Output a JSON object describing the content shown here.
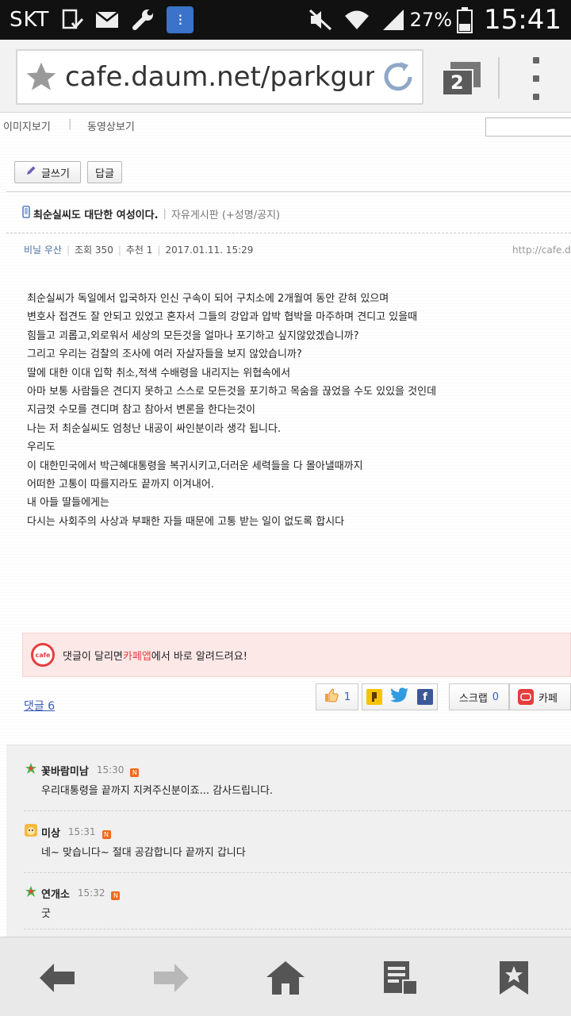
{
  "status_bar": {
    "carrier": "SKT",
    "battery_percent": "27%",
    "time": "15:41"
  },
  "browser": {
    "url": "cafe.daum.net/parkgun",
    "tab_count": "2"
  },
  "page": {
    "top_nav": {
      "image_view": "이미지보기",
      "separator": "|",
      "video_view": "동영상보기"
    },
    "buttons": {
      "write": "글쓰기",
      "reply": "답글"
    },
    "post": {
      "title": "최순실씨도 대단한 여성이다.",
      "title_sep": "|",
      "board": "자유게시판 (+성명/공지)",
      "author": "비닐 우산",
      "views": "조회 350",
      "recommends": "추천 1",
      "date": "2017.01.11. 15:29",
      "source_url": "http://cafe.d",
      "body_lines": [
        "최순실씨가 독일에서 입국하자 인신 구속이 되어 구치소에 2개월여 동안 갇혀 있으며",
        "변호사 접견도 잘 안되고 있었고 혼자서 그들의 강압과 압박 협박을 마주하며 견디고 있을때",
        "힘들고 괴롭고,외로워서 세상의 모든것을 얼마나 포기하고 싶지않았겠습니까?",
        "그리고 우리는 검찰의 조사에 여러 자살자들을 보지 않았습니까?",
        "딸에 대한 이대 입학 취소,적색 수배령을 내리지는 위협속에서",
        "아마 보통 사람들은 견디지 못하고 스스로 모든것을 포기하고 목숨을 끊었을 수도 있있을 것인데",
        "지금껏 수모를 견디며 참고 참아서 변론을 한다는것이",
        "나는 저 최순실씨도 엄청난 내공이 싸인분이라 생각 됩니다.",
        "우리도",
        "이 대한민국에서 박근혜대통령을 복귀시키고,더러운 세력들을 다 몰아낼때까지",
        "어떠한 고통이 따를지라도 끝까지 이겨내어.",
        "내 아들 딸들에게는",
        "다시는 사회주의 사상과 부패한 자들 때문에 고통 받는 일이 없도록 합시다"
      ]
    },
    "notice": {
      "badge": "cafe",
      "text_before": "댓글이 달리면 ",
      "highlight": "카페앱",
      "text_after": "에서 바로 알려드려요!"
    },
    "comment_count_label": "댓글 6",
    "share": {
      "like_count": "1",
      "scrap_label": "스크랩",
      "scrap_count": "0",
      "cafe_label": "카페"
    },
    "comments": [
      {
        "name": "꽃바람미남",
        "time": "15:30",
        "new": "N",
        "text": "우리대통령을 끝까지 지켜주신분이죠... 감사드립니다."
      },
      {
        "name": "미상",
        "time": "15:31",
        "new": "N",
        "text": "네~ 맞습니다~ 절대 공감합니다 끝까지 갑니다"
      },
      {
        "name": "연개소",
        "time": "15:32",
        "new": "N",
        "text": "굿"
      }
    ]
  },
  "icons": {
    "status": [
      "screenshot-check-icon",
      "mail-icon",
      "wrench-icon",
      "app-tile-icon",
      "mute-icon",
      "wifi-icon",
      "signal-icon",
      "battery-icon"
    ],
    "browser": [
      "bookmark-star-icon",
      "reload-icon",
      "tabs-icon",
      "overflow-menu-icon"
    ],
    "bottom_nav": [
      "back-arrow-icon",
      "forward-arrow-icon",
      "home-icon",
      "reading-list-icon",
      "bookmark-icon"
    ]
  },
  "colors": {
    "accent_red": "#e63d3d",
    "link_blue": "#3b5bb5",
    "author_blue": "#4a6fa5"
  }
}
